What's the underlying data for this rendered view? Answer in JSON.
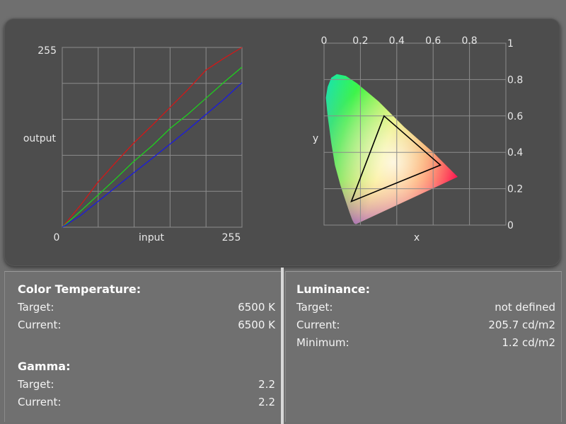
{
  "curves_chart": {
    "type": "line",
    "x_axis": {
      "label": "input",
      "min_label": "0",
      "max_label": "255"
    },
    "y_axis": {
      "label": "output",
      "max_label": "255"
    },
    "xlim": [
      0,
      255
    ],
    "ylim": [
      0,
      255
    ],
    "series": [
      {
        "color": "#d21818",
        "points": [
          [
            0,
            0
          ],
          [
            25,
            30
          ],
          [
            50,
            63
          ],
          [
            75,
            91
          ],
          [
            100,
            118
          ],
          [
            128,
            145
          ],
          [
            153,
            170
          ],
          [
            178,
            195
          ],
          [
            204,
            223
          ],
          [
            230,
            240
          ],
          [
            255,
            255
          ]
        ]
      },
      {
        "color": "#1ed01e",
        "points": [
          [
            0,
            0
          ],
          [
            25,
            22
          ],
          [
            50,
            45
          ],
          [
            75,
            68
          ],
          [
            100,
            92
          ],
          [
            128,
            116
          ],
          [
            153,
            140
          ],
          [
            178,
            160
          ],
          [
            204,
            183
          ],
          [
            230,
            206
          ],
          [
            255,
            227
          ]
        ]
      },
      {
        "color": "#1a1ae0",
        "points": [
          [
            0,
            0
          ],
          [
            25,
            16
          ],
          [
            50,
            36
          ],
          [
            75,
            56
          ],
          [
            100,
            76
          ],
          [
            128,
            98
          ],
          [
            153,
            118
          ],
          [
            178,
            138
          ],
          [
            204,
            160
          ],
          [
            230,
            182
          ],
          [
            255,
            205
          ]
        ]
      }
    ]
  },
  "chromaticity_chart": {
    "type": "scatter",
    "x_axis": {
      "label": "x",
      "ticks": [
        "0",
        "0.2",
        "0.4",
        "0.6",
        "0.8"
      ]
    },
    "y_axis": {
      "label": "y",
      "ticks": [
        "0",
        "0.2",
        "0.4",
        "0.6",
        "0.8",
        "1"
      ]
    },
    "xlim": [
      0,
      1
    ],
    "ylim": [
      0,
      1
    ],
    "gamut_triangle": [
      [
        0.64,
        0.33
      ],
      [
        0.33,
        0.6
      ],
      [
        0.15,
        0.13
      ]
    ],
    "locus": [
      [
        0.175,
        0.005
      ],
      [
        0.165,
        0.01
      ],
      [
        0.155,
        0.03
      ],
      [
        0.14,
        0.07
      ],
      [
        0.12,
        0.13
      ],
      [
        0.09,
        0.22
      ],
      [
        0.06,
        0.33
      ],
      [
        0.04,
        0.45
      ],
      [
        0.02,
        0.6
      ],
      [
        0.01,
        0.7
      ],
      [
        0.02,
        0.76
      ],
      [
        0.04,
        0.81
      ],
      [
        0.07,
        0.83
      ],
      [
        0.12,
        0.82
      ],
      [
        0.18,
        0.78
      ],
      [
        0.24,
        0.73
      ],
      [
        0.3,
        0.68
      ],
      [
        0.37,
        0.61
      ],
      [
        0.44,
        0.54
      ],
      [
        0.52,
        0.47
      ],
      [
        0.6,
        0.4
      ],
      [
        0.67,
        0.33
      ],
      [
        0.735,
        0.265
      ]
    ]
  },
  "color_temperature": {
    "heading": "Color Temperature:",
    "target_label": "Target:",
    "target_value": "6500 K",
    "current_label": "Current:",
    "current_value": "6500 K"
  },
  "gamma": {
    "heading": "Gamma:",
    "target_label": "Target:",
    "target_value": "2.2",
    "current_label": "Current:",
    "current_value": "2.2"
  },
  "luminance": {
    "heading": "Luminance:",
    "target_label": "Target:",
    "target_value": "not defined",
    "current_label": "Current:",
    "current_value": "205.7 cd/m2",
    "minimum_label": "Minimum:",
    "minimum_value": "1.2 cd/m2"
  }
}
